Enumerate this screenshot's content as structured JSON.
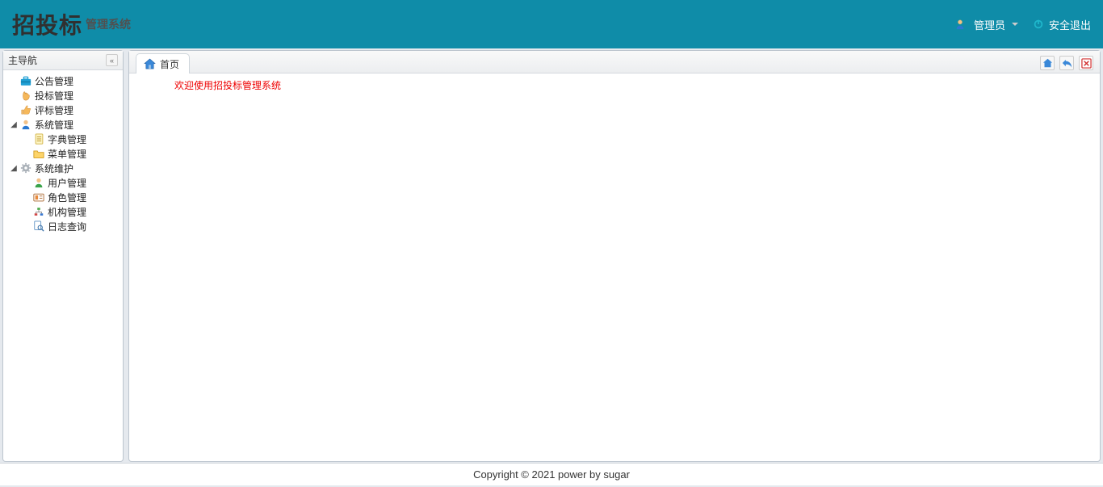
{
  "header": {
    "logo_main": "招投标",
    "logo_sub": "管理系统",
    "user_label": "管理员",
    "logout_label": "安全退出"
  },
  "sidebar": {
    "title": "主导航",
    "items": [
      {
        "icon": "briefcase",
        "label": "公告管理",
        "expandable": false,
        "indent": 0
      },
      {
        "icon": "hand",
        "label": "投标管理",
        "expandable": false,
        "indent": 0
      },
      {
        "icon": "thumbs-up",
        "label": "评标管理",
        "expandable": false,
        "indent": 0
      },
      {
        "icon": "user",
        "label": "系统管理",
        "expandable": true,
        "indent": 0,
        "expanded": true
      },
      {
        "icon": "document",
        "label": "字典管理",
        "expandable": false,
        "indent": 1
      },
      {
        "icon": "folder",
        "label": "菜单管理",
        "expandable": false,
        "indent": 1
      },
      {
        "icon": "gear",
        "label": "系统维护",
        "expandable": true,
        "indent": 0,
        "expanded": true
      },
      {
        "icon": "user",
        "label": "用户管理",
        "expandable": false,
        "indent": 1
      },
      {
        "icon": "id-card",
        "label": "角色管理",
        "expandable": false,
        "indent": 1
      },
      {
        "icon": "org",
        "label": "机构管理",
        "expandable": false,
        "indent": 1
      },
      {
        "icon": "search-doc",
        "label": "日志查询",
        "expandable": false,
        "indent": 1
      }
    ]
  },
  "tabs": {
    "items": [
      {
        "icon": "home",
        "label": "首页"
      }
    ]
  },
  "content": {
    "welcome": "欢迎使用招投标管理系统"
  },
  "footer": {
    "text": "Copyright © 2021 power by sugar"
  }
}
